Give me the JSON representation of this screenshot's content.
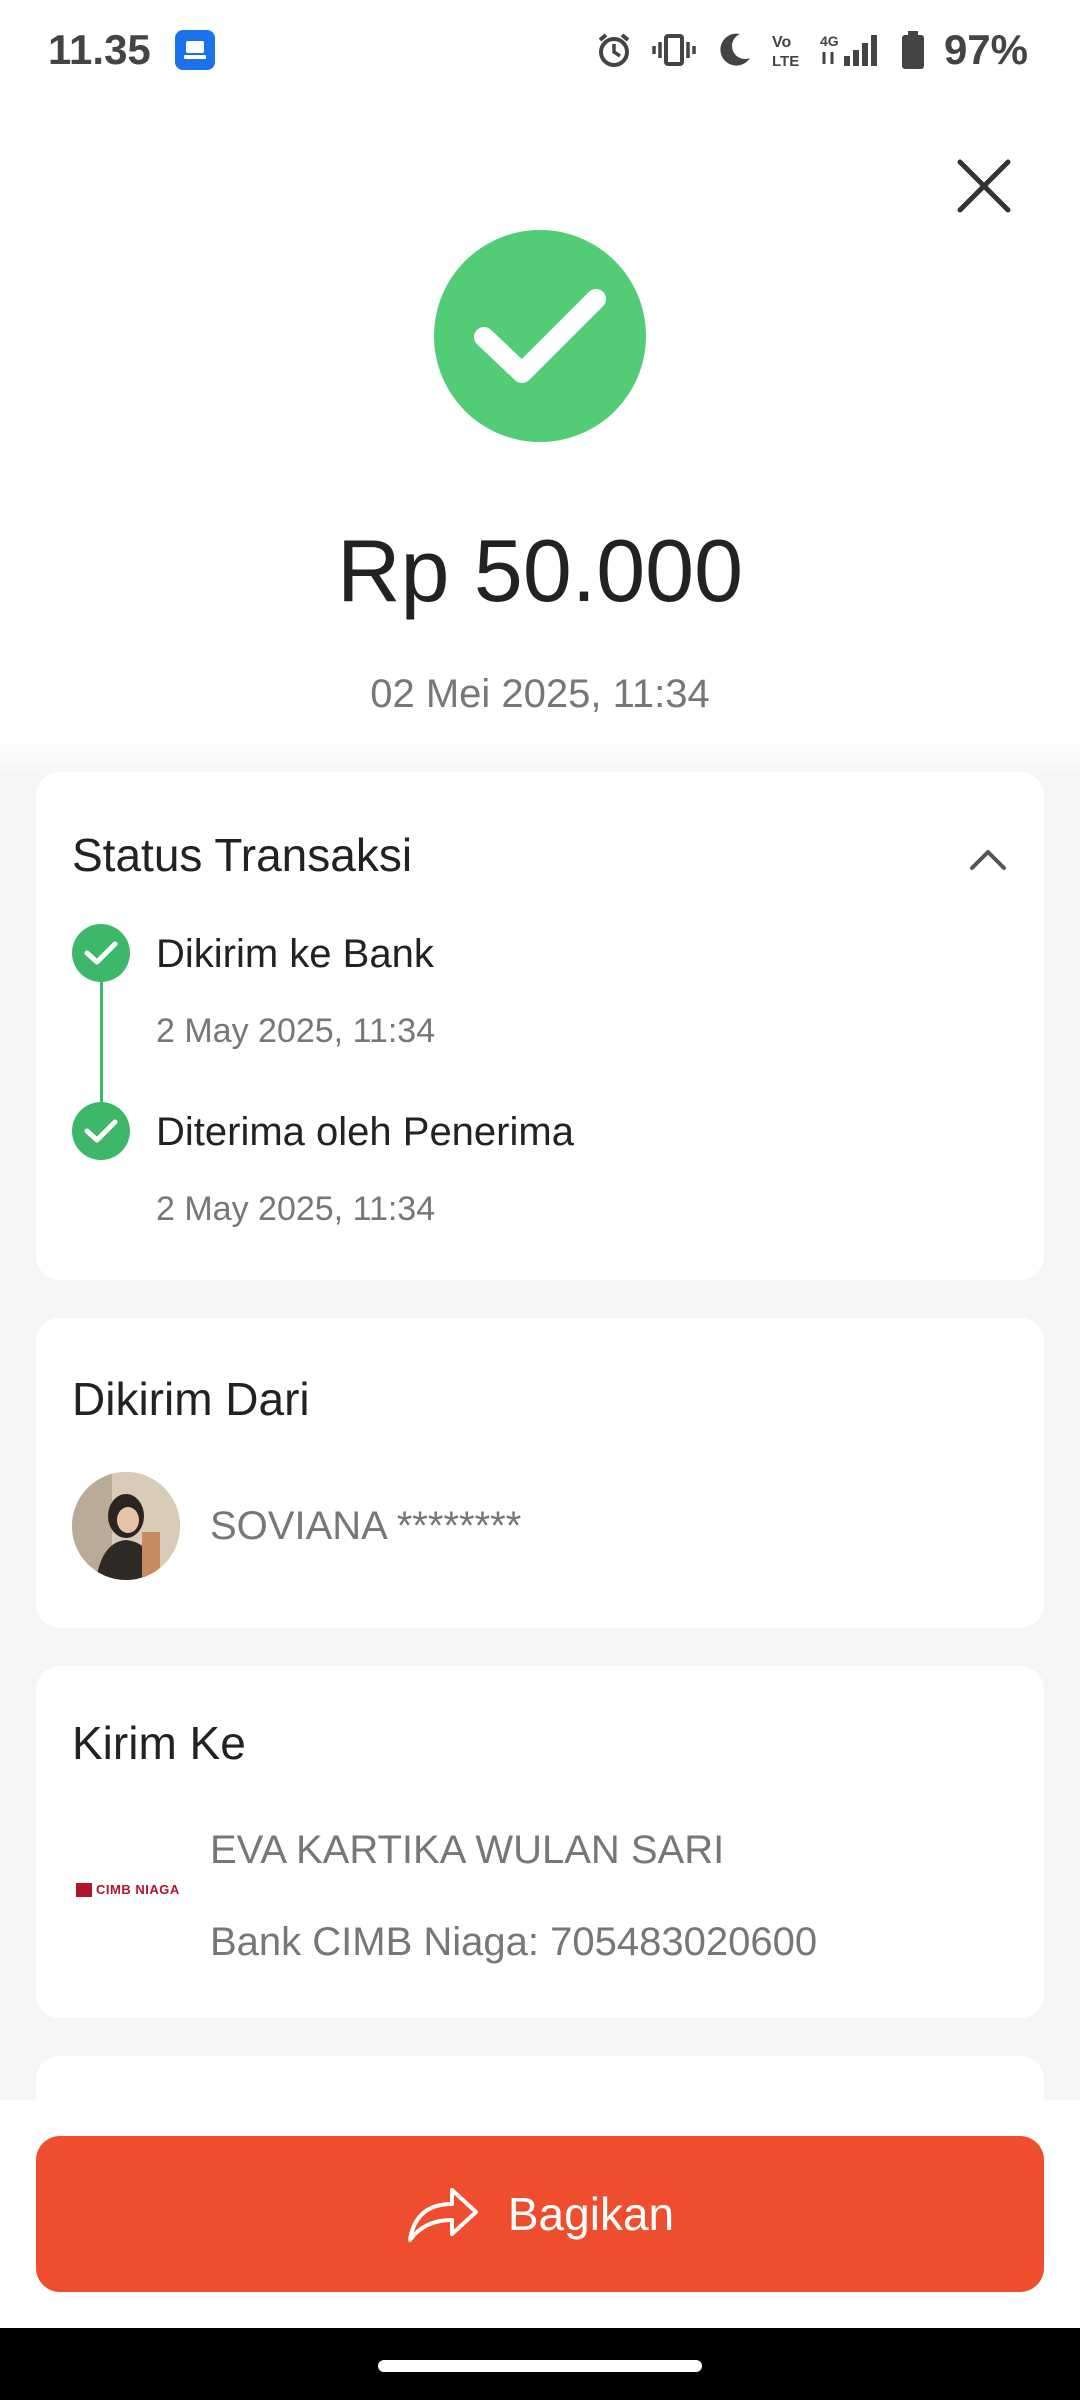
{
  "status_bar": {
    "time": "11.35",
    "battery": "97%",
    "icons": [
      "app-notification-icon",
      "alarm-icon",
      "vibrate-icon",
      "moon-icon",
      "volte-icon",
      "network-4g-icon",
      "signal-icon",
      "battery-icon"
    ]
  },
  "header": {
    "close_icon": "close-icon",
    "success_icon": "checkmark-icon",
    "amount": "Rp 50.000",
    "datetime": "02 Mei 2025, 11:34"
  },
  "status_card": {
    "title": "Status Transaksi",
    "steps": [
      {
        "label": "Dikirim ke Bank",
        "date": "2 May 2025, 11:34"
      },
      {
        "label": "Diterima oleh Penerima",
        "date": "2 May 2025, 11:34"
      }
    ]
  },
  "from_card": {
    "title": "Dikirim Dari",
    "name": "SOVIANA ********"
  },
  "to_card": {
    "title": "Kirim Ke",
    "bank_logo_text": "CIMB NIAGA",
    "name": "EVA KARTIKA WULAN SARI",
    "account": "Bank CIMB Niaga: 705483020600"
  },
  "share_button": {
    "label": "Bagikan"
  },
  "colors": {
    "success_green": "#52cc77",
    "step_green": "#3cb868",
    "accent_orange": "#ee4e2e",
    "background_gray": "#f5f5f5"
  }
}
